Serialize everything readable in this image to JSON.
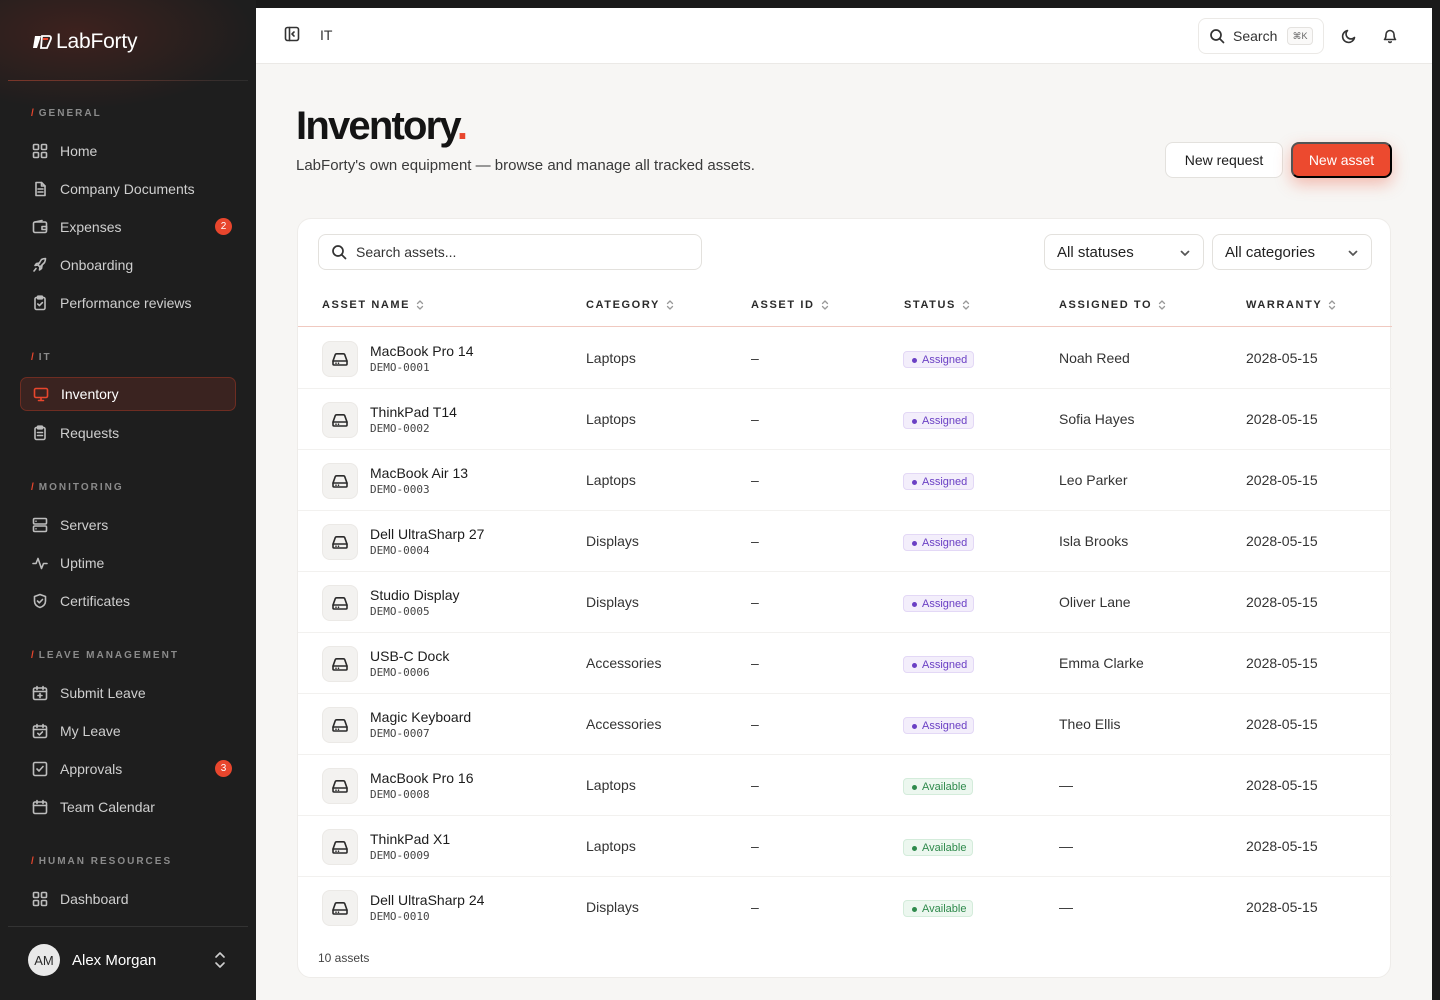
{
  "brand": {
    "name": "LabForty"
  },
  "sidebar": {
    "sections": [
      {
        "label": "GENERAL"
      },
      {
        "label": "IT"
      },
      {
        "label": "MONITORING"
      },
      {
        "label": "LEAVE MANAGEMENT"
      },
      {
        "label": "HUMAN RESOURCES"
      }
    ],
    "items": [
      {
        "label": "Home",
        "icon": "grid-icon"
      },
      {
        "label": "Company Documents",
        "icon": "document-icon"
      },
      {
        "label": "Expenses",
        "icon": "wallet-icon",
        "badge": "2"
      },
      {
        "label": "Onboarding",
        "icon": "rocket-icon"
      },
      {
        "label": "Performance reviews",
        "icon": "clipboard-check-icon"
      },
      {
        "label": "Inventory",
        "icon": "monitor-icon",
        "active": true
      },
      {
        "label": "Requests",
        "icon": "clipboard-list-icon"
      },
      {
        "label": "Servers",
        "icon": "server-icon"
      },
      {
        "label": "Uptime",
        "icon": "activity-icon"
      },
      {
        "label": "Certificates",
        "icon": "shield-check-icon"
      },
      {
        "label": "Submit Leave",
        "icon": "calendar-plus-icon"
      },
      {
        "label": "My Leave",
        "icon": "calendar-check-icon"
      },
      {
        "label": "Approvals",
        "icon": "check-square-icon",
        "badge": "3"
      },
      {
        "label": "Team Calendar",
        "icon": "calendar-icon"
      },
      {
        "label": "Dashboard",
        "icon": "grid-icon"
      }
    ],
    "user": {
      "initials": "AM",
      "name": "Alex Morgan"
    }
  },
  "topbar": {
    "breadcrumb": "IT",
    "search_label": "Search",
    "search_shortcut": "⌘K"
  },
  "page": {
    "title": "Inventory",
    "title_dot": ".",
    "subtitle": "LabForty's own equipment — browse and manage all tracked assets.",
    "new_request_label": "New request",
    "new_asset_label": "New asset"
  },
  "filters": {
    "search_placeholder": "Search assets...",
    "status_selected": "All statuses",
    "category_selected": "All categories"
  },
  "table": {
    "columns": [
      "ASSET NAME",
      "CATEGORY",
      "ASSET ID",
      "STATUS",
      "ASSIGNED TO",
      "WARRANTY"
    ],
    "rows": [
      {
        "name": "MacBook Pro 14",
        "code": "DEMO-0001",
        "category": "Laptops",
        "asset_id": "–",
        "status": "Assigned",
        "assigned_to": "Noah Reed",
        "warranty": "2028-05-15"
      },
      {
        "name": "ThinkPad T14",
        "code": "DEMO-0002",
        "category": "Laptops",
        "asset_id": "–",
        "status": "Assigned",
        "assigned_to": "Sofia Hayes",
        "warranty": "2028-05-15"
      },
      {
        "name": "MacBook Air 13",
        "code": "DEMO-0003",
        "category": "Laptops",
        "asset_id": "–",
        "status": "Assigned",
        "assigned_to": "Leo Parker",
        "warranty": "2028-05-15"
      },
      {
        "name": "Dell UltraSharp 27",
        "code": "DEMO-0004",
        "category": "Displays",
        "asset_id": "–",
        "status": "Assigned",
        "assigned_to": "Isla Brooks",
        "warranty": "2028-05-15"
      },
      {
        "name": "Studio Display",
        "code": "DEMO-0005",
        "category": "Displays",
        "asset_id": "–",
        "status": "Assigned",
        "assigned_to": "Oliver Lane",
        "warranty": "2028-05-15"
      },
      {
        "name": "USB-C Dock",
        "code": "DEMO-0006",
        "category": "Accessories",
        "asset_id": "–",
        "status": "Assigned",
        "assigned_to": "Emma Clarke",
        "warranty": "2028-05-15"
      },
      {
        "name": "Magic Keyboard",
        "code": "DEMO-0007",
        "category": "Accessories",
        "asset_id": "–",
        "status": "Assigned",
        "assigned_to": "Theo Ellis",
        "warranty": "2028-05-15"
      },
      {
        "name": "MacBook Pro 16",
        "code": "DEMO-0008",
        "category": "Laptops",
        "asset_id": "–",
        "status": "Available",
        "assigned_to": "—",
        "warranty": "2028-05-15"
      },
      {
        "name": "ThinkPad X1",
        "code": "DEMO-0009",
        "category": "Laptops",
        "asset_id": "–",
        "status": "Available",
        "assigned_to": "—",
        "warranty": "2028-05-15"
      },
      {
        "name": "Dell UltraSharp 24",
        "code": "DEMO-0010",
        "category": "Displays",
        "asset_id": "–",
        "status": "Available",
        "assigned_to": "—",
        "warranty": "2028-05-15"
      }
    ],
    "footer": "10 assets"
  },
  "colors": {
    "accent": "#e8462d",
    "assigned": "#6a3fc4",
    "available": "#2f8a4c",
    "sidebar_bg": "#1e1e1e"
  }
}
